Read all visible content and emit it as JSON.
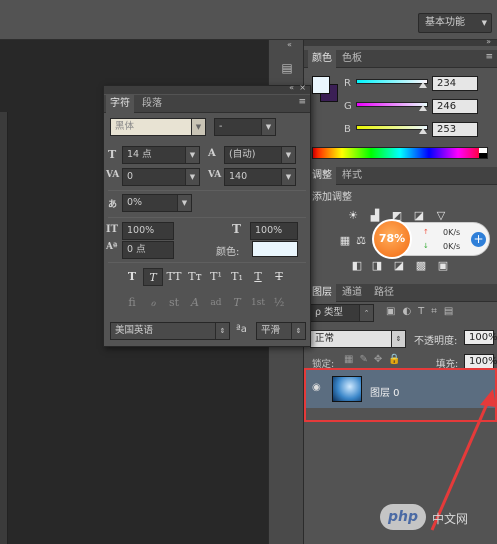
{
  "topbar": {
    "workspace_label": "基本功能"
  },
  "color_panel": {
    "tabs": [
      "颜色",
      "色板"
    ],
    "channels": [
      {
        "label": "R",
        "value": "234"
      },
      {
        "label": "G",
        "value": "246"
      },
      {
        "label": "B",
        "value": "253"
      }
    ],
    "foreground_color": "#eaf6fd",
    "background_color": "#3b1f55"
  },
  "adjust_panel": {
    "tabs": [
      "调整",
      "样式"
    ],
    "title": "添加调整",
    "speed_widget": {
      "percent": "78%",
      "up": "0K/s",
      "down": "0K/s"
    }
  },
  "layers_panel": {
    "tabs": [
      "图层",
      "通道",
      "路径"
    ],
    "filter_label": "ρ 类型",
    "blend_mode": "正常",
    "opacity_label": "不透明度:",
    "opacity_value": "100%",
    "lock_label": "锁定:",
    "fill_label": "填充:",
    "fill_value": "100%",
    "layer_name": "图层 0"
  },
  "char_panel": {
    "tabs": [
      "字符",
      "段落"
    ],
    "font_family": "黑体",
    "font_style": "-",
    "font_size": "14 点",
    "leading": "(自动)",
    "kerning": "0",
    "tracking": "140",
    "tsume": "0%",
    "vertical_scale": "100%",
    "horizontal_scale": "100%",
    "baseline_shift": "0 点",
    "color_label": "颜色:",
    "text_color": "#eaf6fd",
    "style_buttons": [
      "T",
      "T",
      "TT",
      "Tт",
      "T¹",
      "T₁",
      "T",
      "T"
    ],
    "opentype_buttons": [
      "fi",
      "ℴ",
      "st",
      "A",
      "ad",
      "T",
      "1st",
      "½"
    ],
    "language": "美国英语",
    "aa_label": "ªa",
    "antialias": "平滑"
  },
  "watermark": {
    "text": "php",
    "suffix": "中文网"
  }
}
